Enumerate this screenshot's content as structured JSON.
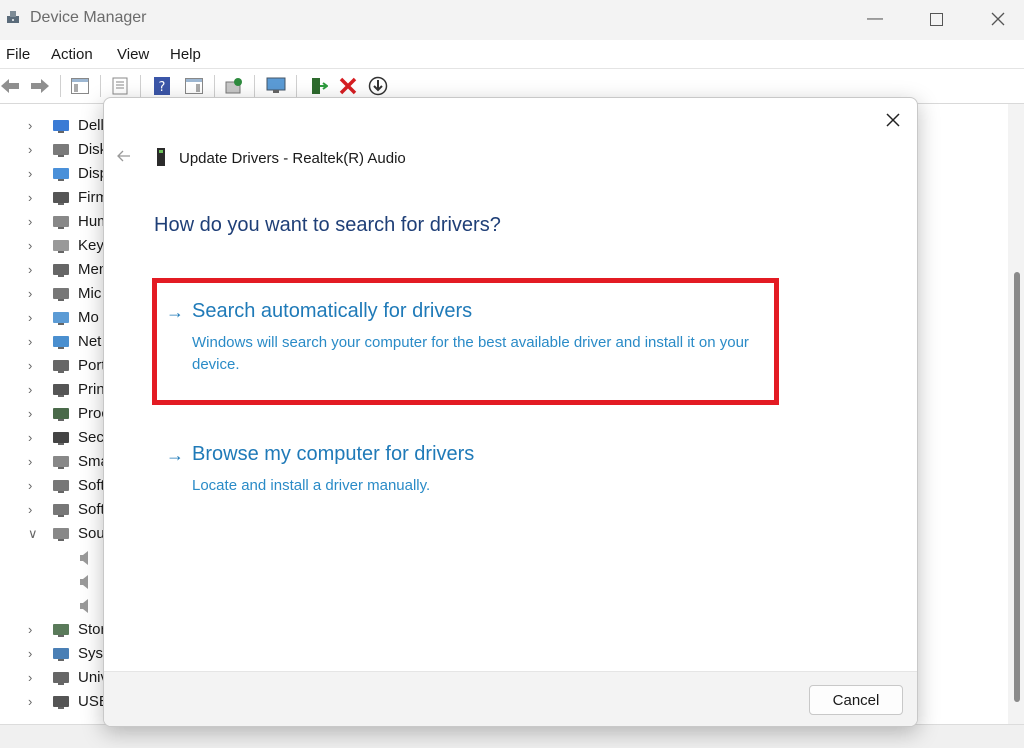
{
  "window": {
    "title": "Device Manager",
    "minimize_icon": "minimize-icon",
    "maximize_icon": "maximize-icon",
    "close_icon": "close-icon"
  },
  "menu": [
    "File",
    "Action",
    "View",
    "Help"
  ],
  "toolbar": {
    "icons": [
      "back-arrow-icon",
      "forward-arrow-icon",
      "properties-icon",
      "help-icon",
      "scan-hardware-icon",
      "monitor-icon",
      "enable-device-icon",
      "uninstall-device-icon",
      "update-driver-icon"
    ]
  },
  "tree": {
    "items": [
      {
        "label": "Dell",
        "expanded": false
      },
      {
        "label": "Disk",
        "expanded": false
      },
      {
        "label": "Disp",
        "expanded": false
      },
      {
        "label": "Firm",
        "expanded": false
      },
      {
        "label": "Hum",
        "expanded": false
      },
      {
        "label": "Key",
        "expanded": false
      },
      {
        "label": "Mem",
        "expanded": false
      },
      {
        "label": "Mic",
        "expanded": false
      },
      {
        "label": "Mo",
        "expanded": false
      },
      {
        "label": "Net",
        "expanded": false
      },
      {
        "label": "Port",
        "expanded": false
      },
      {
        "label": "Prin",
        "expanded": false
      },
      {
        "label": "Proc",
        "expanded": false
      },
      {
        "label": "Secu",
        "expanded": false
      },
      {
        "label": "Sma",
        "expanded": false
      },
      {
        "label": "Soft",
        "expanded": false
      },
      {
        "label": "Soft",
        "expanded": false
      },
      {
        "label": "Sou",
        "expanded": true
      },
      {
        "label": "",
        "expanded": null
      },
      {
        "label": "",
        "expanded": null
      },
      {
        "label": "",
        "expanded": null
      },
      {
        "label": "Stor",
        "expanded": false
      },
      {
        "label": "Syst",
        "expanded": false
      },
      {
        "label": "Univ",
        "expanded": false
      },
      {
        "label": "USB",
        "expanded": false
      }
    ]
  },
  "dialog": {
    "title": "Update Drivers - Realtek(R) Audio",
    "heading": "How do you want to search for drivers?",
    "option_auto": {
      "arrow": "→",
      "title": "Search automatically for drivers",
      "description": "Windows will search your computer for the best available driver and install it on your device."
    },
    "option_browse": {
      "arrow": "→",
      "title": "Browse my computer for drivers",
      "description": "Locate and install a driver manually."
    },
    "cancel_label": "Cancel",
    "highlight_color": "#e31b23",
    "link_color": "#1f7ab8",
    "heading_color": "#1f3f77"
  }
}
